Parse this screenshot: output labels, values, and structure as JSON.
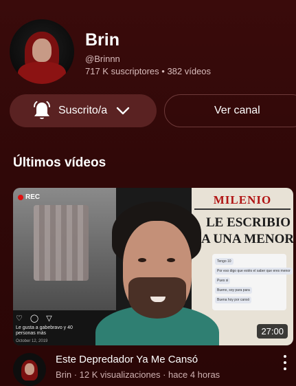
{
  "channel": {
    "name": "Brin",
    "handle": "@Brinnn",
    "stats": "717 K suscriptores • 382 vídeos"
  },
  "actions": {
    "subscribed_label": "Suscrito/a",
    "view_channel_label": "Ver canal"
  },
  "section": {
    "title": "Últimos vídeos"
  },
  "video": {
    "title": "Este Depredador Ya Me Cansó",
    "meta": "Brin · 12 K visualizaciones · hace 4 horas",
    "duration": "27:00",
    "thumbnail": {
      "rec_label": "REC",
      "newspaper_name": "MILENIO",
      "headline_line1": "LE ESCRIBIO",
      "headline_line2": "A UNA MENOR",
      "post_icons": "♡ ◯ ▽",
      "post_likes": "Le gusta a gabebravo y 40 personas más",
      "post_date": "October 12, 2019",
      "chat_messages": [
        "Tengo 10",
        "Por eso digo que estés el saber que eres menor",
        "Pues si",
        "Bueno, soy para para",
        "Buena hoy por cansó"
      ]
    }
  },
  "icons": {
    "bell": "bell-icon",
    "chevron": "chevron-down-icon",
    "more": "more-vert-icon"
  },
  "colors": {
    "background": "#2e0808",
    "button_fill": "#5a2222",
    "button_outline": "#6e3a3a",
    "secondary_text": "#d9bcbc"
  }
}
